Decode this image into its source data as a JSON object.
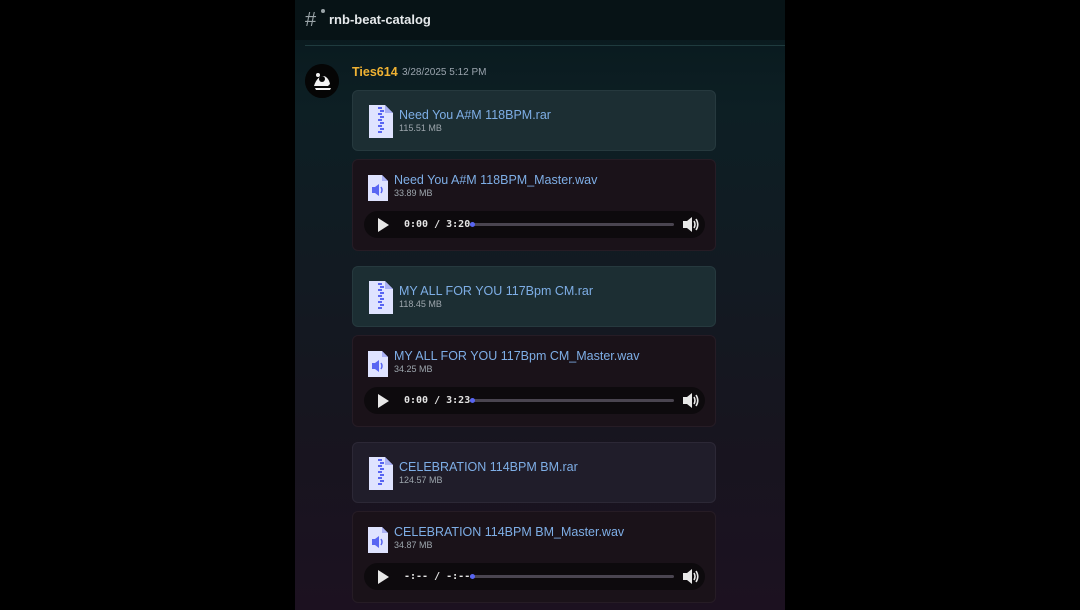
{
  "channel": {
    "name": "rnb-beat-catalog",
    "icon": "hash-icon"
  },
  "message": {
    "author": "Ties614",
    "timestamp": "3/28/2025 5:12 PM",
    "author_color": "#f0b233"
  },
  "attachments": [
    {
      "name": "Need You A#M 118BPM.rar",
      "size": "115.51 MB",
      "icon": "zip-file-icon"
    },
    {
      "name": "Need You A#M 118BPM_Master.wav",
      "size": "33.89 MB",
      "icon": "audio-file-icon",
      "time": "0:00 / 3:20",
      "progress": 0
    },
    {
      "name": "MY ALL FOR YOU 117Bpm CM.rar",
      "size": "118.45 MB",
      "icon": "zip-file-icon"
    },
    {
      "name": "MY ALL FOR YOU 117Bpm CM_Master.wav",
      "size": "34.25 MB",
      "icon": "audio-file-icon",
      "time": "0:00 / 3:23",
      "progress": 0
    },
    {
      "name": "CELEBRATION 114BPM BM.rar",
      "size": "124.57 MB",
      "icon": "zip-file-icon"
    },
    {
      "name": "CELEBRATION 114BPM BM_Master.wav",
      "size": "34.87 MB",
      "icon": "audio-file-icon",
      "time": "-:-- / -:--",
      "progress": 0
    }
  ],
  "colors": {
    "link": "#7eaee6",
    "accent": "#5865f2"
  }
}
